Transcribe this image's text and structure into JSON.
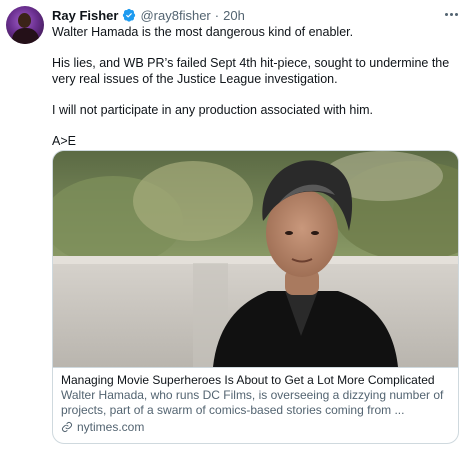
{
  "author": {
    "name": "Ray Fisher",
    "handle": "@ray8fisher",
    "separator": "·",
    "time": "20h",
    "verified_icon": "verified-badge-icon",
    "verified_color": "#1d9bf0"
  },
  "tweet": {
    "lines": [
      "Walter Hamada is the most dangerous kind of enabler.",
      "His lies, and WB PR’s failed Sept 4th hit-piece, sought to undermine the very real issues of the Justice League investigation.",
      "I will not participate in any production associated with him.",
      "A>E"
    ]
  },
  "card": {
    "title": "Managing Movie Superheroes Is About to Get a Lot More Complicated",
    "description": "Walter Hamada, who runs DC Films, is overseeing a dizzying number of projects, part of a swarm of comics-based stories coming from ...",
    "domain": "nytimes.com",
    "link_icon": "link-icon"
  },
  "icons": {
    "more": "more-options-icon"
  },
  "colors": {
    "text": "#0f1419",
    "secondary": "#536471",
    "border": "#cfd9de"
  }
}
